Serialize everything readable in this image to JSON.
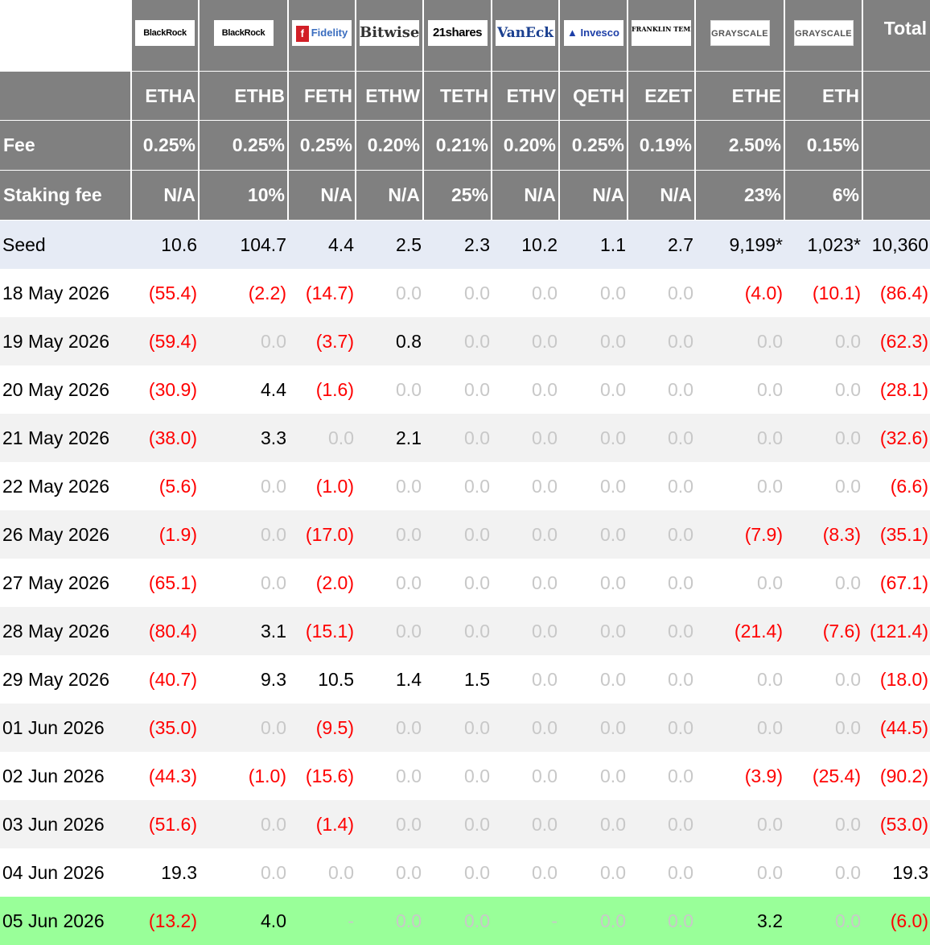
{
  "header": {
    "total_label": "Total",
    "fee_label": "Fee",
    "staking_label": "Staking fee",
    "funds": [
      {
        "issuer": "BlackRock",
        "logo_icon": "blackrock-logo",
        "ticker": "ETHA",
        "fee": "0.25%",
        "staking_fee": "N/A"
      },
      {
        "issuer": "BlackRock",
        "logo_icon": "blackrock-logo",
        "ticker": "ETHB",
        "fee": "0.25%",
        "staking_fee": "10%"
      },
      {
        "issuer": "Fidelity",
        "logo_icon": "fidelity-logo",
        "ticker": "FETH",
        "fee": "0.25%",
        "staking_fee": "N/A"
      },
      {
        "issuer": "Bitwise",
        "logo_icon": "bitwise-logo",
        "ticker": "ETHW",
        "fee": "0.20%",
        "staking_fee": "N/A"
      },
      {
        "issuer": "21shares",
        "logo_icon": "21shares-logo",
        "ticker": "TETH",
        "fee": "0.21%",
        "staking_fee": "25%"
      },
      {
        "issuer": "VanEck",
        "logo_icon": "vaneck-logo",
        "ticker": "ETHV",
        "fee": "0.20%",
        "staking_fee": "N/A"
      },
      {
        "issuer": "Invesco",
        "logo_icon": "invesco-logo",
        "ticker": "QETH",
        "fee": "0.25%",
        "staking_fee": "N/A"
      },
      {
        "issuer": "FRANKLIN TEMPLETON",
        "logo_icon": "franklin-templeton-logo",
        "ticker": "EZET",
        "fee": "0.19%",
        "staking_fee": "N/A"
      },
      {
        "issuer": "GRAYSCALE",
        "logo_icon": "grayscale-logo",
        "ticker": "ETHE",
        "fee": "2.50%",
        "staking_fee": "23%"
      },
      {
        "issuer": "GRAYSCALE",
        "logo_icon": "grayscale-logo",
        "ticker": "ETH",
        "fee": "0.15%",
        "staking_fee": "6%"
      }
    ]
  },
  "rows": [
    {
      "date": "Seed",
      "values": [
        "10.6",
        "104.7",
        "4.4",
        "2.5",
        "2.3",
        "10.2",
        "1.1",
        "2.7",
        "9,199*",
        "1,023*"
      ],
      "total": "10,360"
    },
    {
      "date": "18 May 2026",
      "values": [
        "(55.4)",
        "(2.2)",
        "(14.7)",
        "0.0",
        "0.0",
        "0.0",
        "0.0",
        "0.0",
        "(4.0)",
        "(10.1)"
      ],
      "total": "(86.4)"
    },
    {
      "date": "19 May 2026",
      "values": [
        "(59.4)",
        "0.0",
        "(3.7)",
        "0.8",
        "0.0",
        "0.0",
        "0.0",
        "0.0",
        "0.0",
        "0.0"
      ],
      "total": "(62.3)"
    },
    {
      "date": "20 May 2026",
      "values": [
        "(30.9)",
        "4.4",
        "(1.6)",
        "0.0",
        "0.0",
        "0.0",
        "0.0",
        "0.0",
        "0.0",
        "0.0"
      ],
      "total": "(28.1)"
    },
    {
      "date": "21 May 2026",
      "values": [
        "(38.0)",
        "3.3",
        "0.0",
        "2.1",
        "0.0",
        "0.0",
        "0.0",
        "0.0",
        "0.0",
        "0.0"
      ],
      "total": "(32.6)"
    },
    {
      "date": "22 May 2026",
      "values": [
        "(5.6)",
        "0.0",
        "(1.0)",
        "0.0",
        "0.0",
        "0.0",
        "0.0",
        "0.0",
        "0.0",
        "0.0"
      ],
      "total": "(6.6)"
    },
    {
      "date": "26 May 2026",
      "values": [
        "(1.9)",
        "0.0",
        "(17.0)",
        "0.0",
        "0.0",
        "0.0",
        "0.0",
        "0.0",
        "(7.9)",
        "(8.3)"
      ],
      "total": "(35.1)"
    },
    {
      "date": "27 May 2026",
      "values": [
        "(65.1)",
        "0.0",
        "(2.0)",
        "0.0",
        "0.0",
        "0.0",
        "0.0",
        "0.0",
        "0.0",
        "0.0"
      ],
      "total": "(67.1)"
    },
    {
      "date": "28 May 2026",
      "values": [
        "(80.4)",
        "3.1",
        "(15.1)",
        "0.0",
        "0.0",
        "0.0",
        "0.0",
        "0.0",
        "(21.4)",
        "(7.6)"
      ],
      "total": "(121.4)"
    },
    {
      "date": "29 May 2026",
      "values": [
        "(40.7)",
        "9.3",
        "10.5",
        "1.4",
        "1.5",
        "0.0",
        "0.0",
        "0.0",
        "0.0",
        "0.0"
      ],
      "total": "(18.0)"
    },
    {
      "date": "01 Jun 2026",
      "values": [
        "(35.0)",
        "0.0",
        "(9.5)",
        "0.0",
        "0.0",
        "0.0",
        "0.0",
        "0.0",
        "0.0",
        "0.0"
      ],
      "total": "(44.5)"
    },
    {
      "date": "02 Jun 2026",
      "values": [
        "(44.3)",
        "(1.0)",
        "(15.6)",
        "0.0",
        "0.0",
        "0.0",
        "0.0",
        "0.0",
        "(3.9)",
        "(25.4)"
      ],
      "total": "(90.2)"
    },
    {
      "date": "03 Jun 2026",
      "values": [
        "(51.6)",
        "0.0",
        "(1.4)",
        "0.0",
        "0.0",
        "0.0",
        "0.0",
        "0.0",
        "0.0",
        "0.0"
      ],
      "total": "(53.0)"
    },
    {
      "date": "04 Jun 2026",
      "values": [
        "19.3",
        "0.0",
        "0.0",
        "0.0",
        "0.0",
        "0.0",
        "0.0",
        "0.0",
        "0.0",
        "0.0"
      ],
      "total": "19.3"
    },
    {
      "date": "05 Jun 2026",
      "values": [
        "(13.2)",
        "4.0",
        "-",
        "0.0",
        "0.0",
        "-",
        "0.0",
        "0.0",
        "3.2",
        "0.0"
      ],
      "total": "(6.0)"
    }
  ],
  "colors": {
    "header_bg": "#808080",
    "negative": "#ff0000",
    "zero": "#c8c8c8",
    "seed_row_bg": "#e6ebf5",
    "alt_row_bg": "#f2f2f2",
    "current_row_bg": "#99ff99"
  }
}
